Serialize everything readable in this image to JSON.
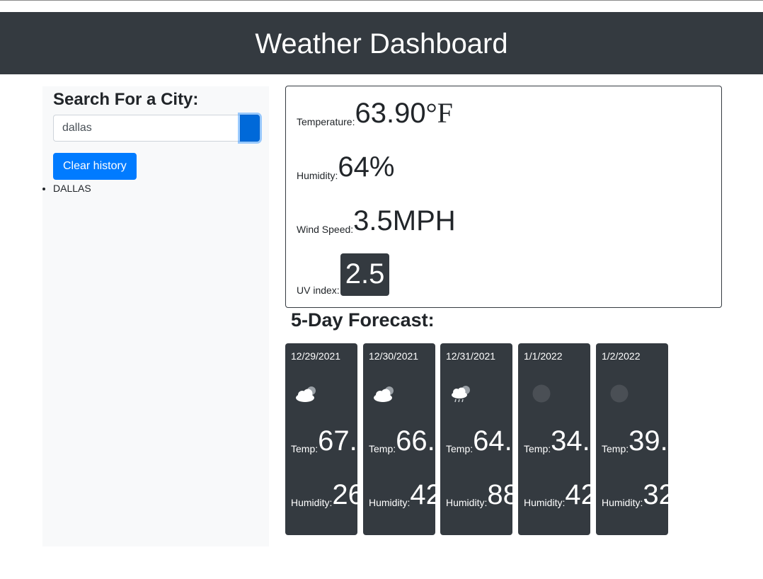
{
  "app": {
    "title": "Weather Dashboard"
  },
  "search": {
    "title": "Search For a City:",
    "value": "dallas",
    "placeholder": "",
    "clear_label": "Clear history",
    "history": [
      "DALLAS"
    ]
  },
  "current": {
    "temperature_label": "Temperature:",
    "temperature_value": "63.90",
    "temperature_unit": "°F",
    "humidity_label": "Humidity:",
    "humidity_value": "64%",
    "wind_label": "Wind Speed:",
    "wind_value": "3.5MPH",
    "uv_label": "UV index:",
    "uv_value": "2.5"
  },
  "forecast": {
    "title": "5-Day Forecast:",
    "temp_label": "Temp:",
    "humidity_label": "Humidity:",
    "days": [
      {
        "date": "12/29/2021",
        "icon": "cloud-sun-icon",
        "temp": "67.",
        "humidity": "26"
      },
      {
        "date": "12/30/2021",
        "icon": "cloud-sun-icon",
        "temp": "66.",
        "humidity": "42"
      },
      {
        "date": "12/31/2021",
        "icon": "cloud-rain-icon",
        "temp": "64.",
        "humidity": "88"
      },
      {
        "date": "1/1/2022",
        "icon": "moon-icon",
        "temp": "34.",
        "humidity": "42"
      },
      {
        "date": "1/2/2022",
        "icon": "moon-icon",
        "temp": "39.",
        "humidity": "32"
      }
    ]
  },
  "colors": {
    "header_bg": "#343a40",
    "primary": "#007bff",
    "card_bg": "#343a40",
    "sidebar_bg": "#f8f9fa"
  }
}
